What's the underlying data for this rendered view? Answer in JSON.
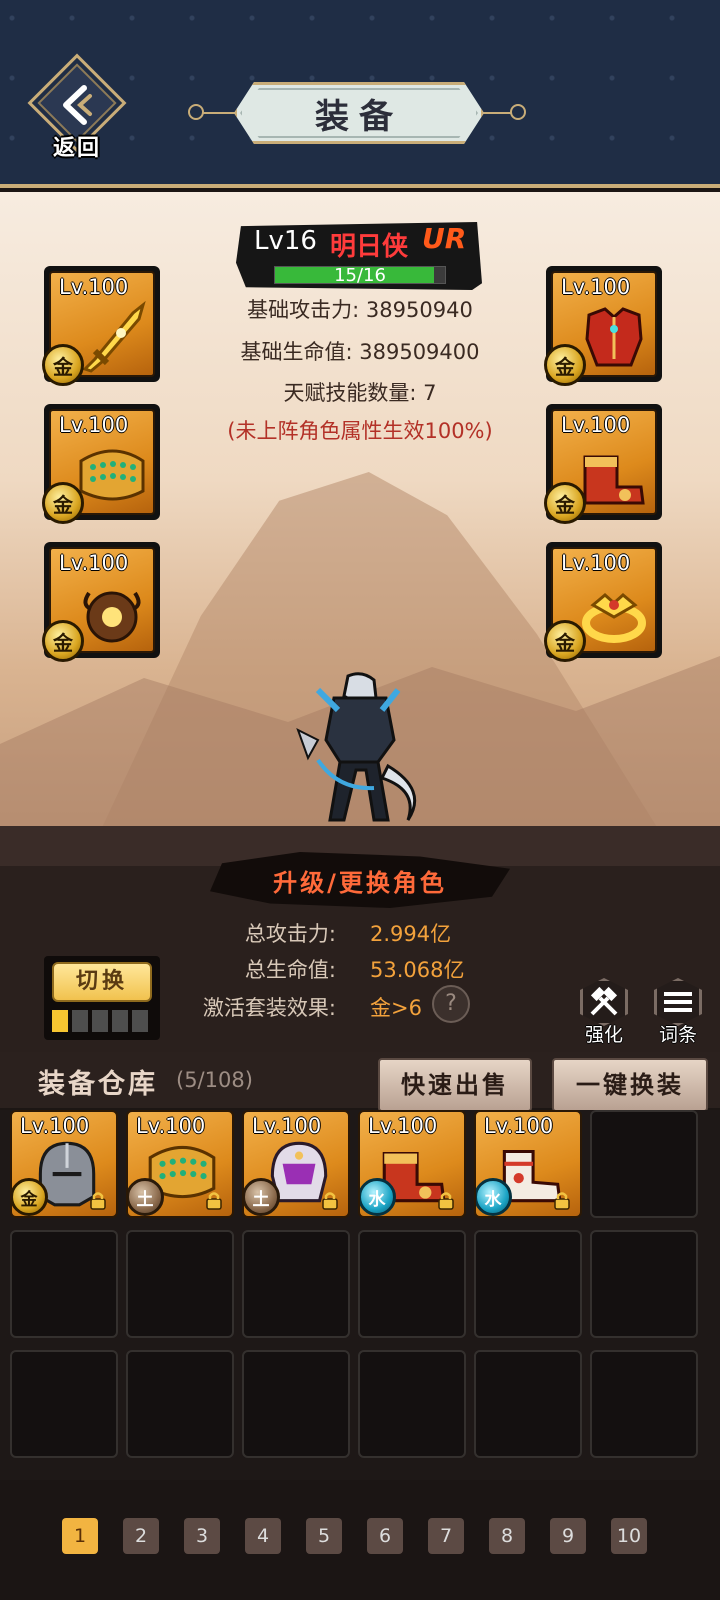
{
  "header": {
    "back_label": "返回",
    "title": "装备"
  },
  "hero": {
    "level": "Lv16",
    "name": "明日侠",
    "rarity": "UR",
    "stars_text": "15/16",
    "stars_progress": 0.9375,
    "stats": [
      "基础攻击力: 38950940",
      "基础生命值: 389509400",
      "天赋技能数量: 7"
    ],
    "note": "(未上阵角色属性生效100%)"
  },
  "equipped": {
    "left": [
      {
        "level": "Lv.100",
        "element": "金",
        "icon": "golden-sword-icon"
      },
      {
        "level": "Lv.100",
        "element": "金",
        "icon": "jeweled-belt-icon"
      },
      {
        "level": "Lv.100",
        "element": "金",
        "icon": "amulet-icon"
      }
    ],
    "right": [
      {
        "level": "Lv.100",
        "element": "金",
        "icon": "red-armor-icon"
      },
      {
        "level": "Lv.100",
        "element": "金",
        "icon": "red-boots-icon"
      },
      {
        "level": "Lv.100",
        "element": "金",
        "icon": "gold-ring-icon"
      }
    ]
  },
  "upgrade_label": "升级/更换角色",
  "totals": {
    "attack_label": "总攻击力:",
    "attack_value": "2.994亿",
    "hp_label": "总生命值:",
    "hp_value": "53.068亿",
    "set_label": "激活套装效果:",
    "set_value": "金>6",
    "help": "?"
  },
  "switch": {
    "label": "切换",
    "slots_on": 1,
    "slots_total": 5
  },
  "tools": {
    "enhance_label": "强化",
    "affix_label": "词条"
  },
  "warehouse": {
    "title": "装备仓库",
    "count": "(5/108)",
    "quick_sell": "快速出售",
    "one_click_equip": "一键换装",
    "items": [
      {
        "level": "Lv.100",
        "element": "金",
        "element_type": "gold",
        "icon": "steel-helmet-icon",
        "locked": true
      },
      {
        "level": "Lv.100",
        "element": "土",
        "element_type": "earth",
        "icon": "jeweled-belt-icon",
        "locked": true
      },
      {
        "level": "Lv.100",
        "element": "土",
        "element_type": "earth",
        "icon": "purple-helmet-icon",
        "locked": true
      },
      {
        "level": "Lv.100",
        "element": "水",
        "element_type": "water",
        "icon": "red-boots-icon",
        "locked": true
      },
      {
        "level": "Lv.100",
        "element": "水",
        "element_type": "water",
        "icon": "white-boots-icon",
        "locked": true
      }
    ]
  },
  "pagination": {
    "pages": [
      "1",
      "2",
      "3",
      "4",
      "5",
      "6",
      "7",
      "8",
      "9",
      "10"
    ],
    "active": "1"
  },
  "colors": {
    "header_bg": "#1f2d45",
    "gold_trim": "#c9ad78",
    "item_orange": "#dd8a1c",
    "accent_orange": "#f3a23c",
    "hp_bar_green": "#38b93a"
  }
}
